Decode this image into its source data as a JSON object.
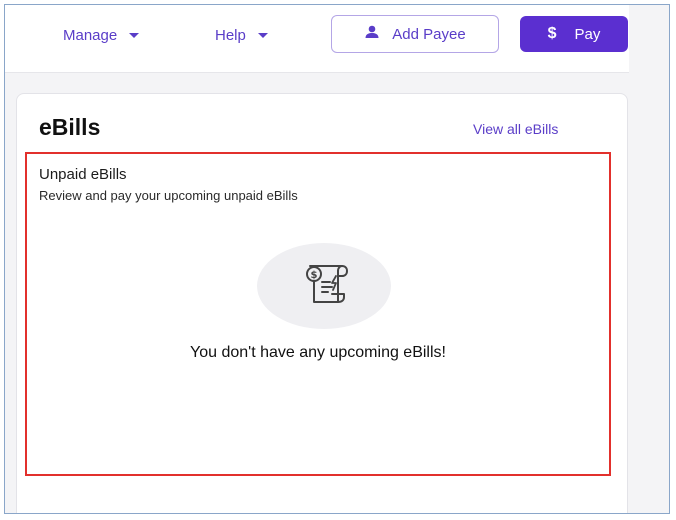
{
  "topbar": {
    "manage_label": "Manage",
    "help_label": "Help",
    "add_payee_label": "Add Payee",
    "pay_label": "Pay",
    "pay_symbol": "$"
  },
  "ebills": {
    "title": "eBills",
    "view_all_label": "View all eBills",
    "unpaid_title": "Unpaid eBills",
    "unpaid_subtitle": "Review and pay your upcoming unpaid eBills",
    "empty_message": "You don't have any upcoming eBills!",
    "empty_icon": "bill-scroll-icon"
  },
  "colors": {
    "accent": "#5b2fd0",
    "highlight_border": "#e2302c"
  }
}
